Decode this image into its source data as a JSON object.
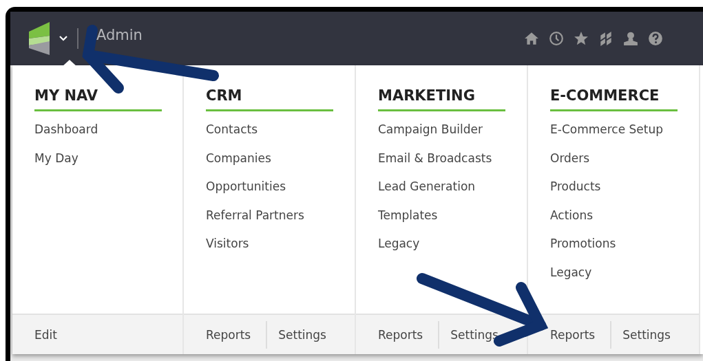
{
  "header": {
    "title": "Admin"
  },
  "menu": {
    "columns": [
      {
        "heading": "MY NAV",
        "items": [
          "Dashboard",
          "My Day"
        ],
        "footer": [
          "Edit"
        ]
      },
      {
        "heading": "CRM",
        "items": [
          "Contacts",
          "Companies",
          "Opportunities",
          "Referral Partners",
          "Visitors"
        ],
        "footer": [
          "Reports",
          "Settings"
        ]
      },
      {
        "heading": "MARKETING",
        "items": [
          "Campaign Builder",
          "Email & Broadcasts",
          "Lead Generation",
          "Templates",
          "Legacy"
        ],
        "footer": [
          "Reports",
          "Settings"
        ]
      },
      {
        "heading": "E-COMMERCE",
        "items": [
          "E-Commerce Setup",
          "Orders",
          "Products",
          "Actions",
          "Promotions",
          "Legacy"
        ],
        "footer": [
          "Reports",
          "Settings"
        ]
      }
    ]
  }
}
